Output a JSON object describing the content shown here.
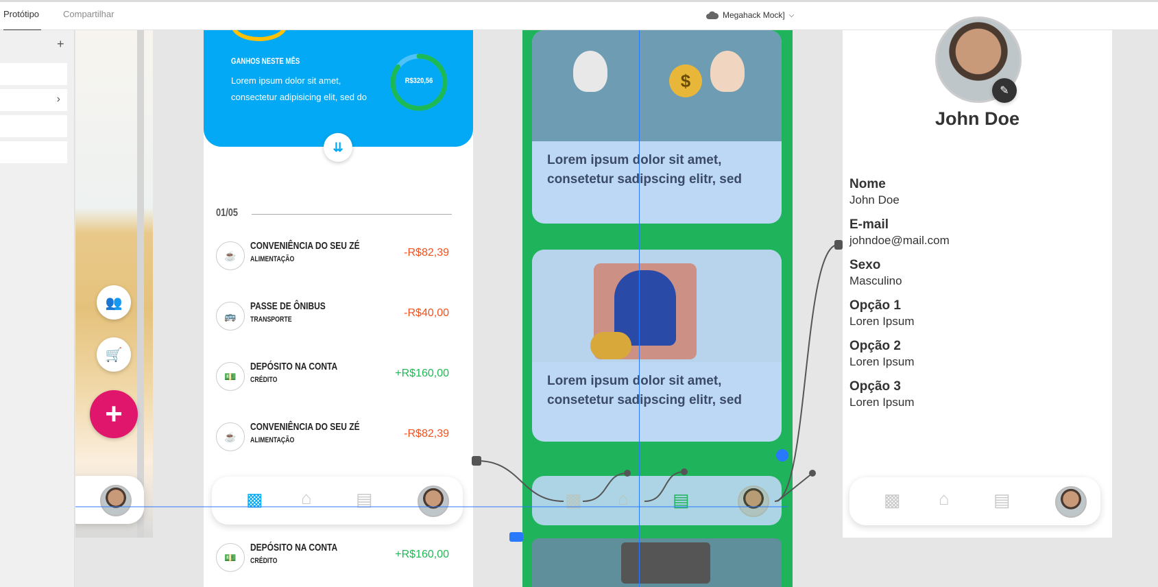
{
  "topbar": {
    "tabs": [
      {
        "label": "Protótipo"
      },
      {
        "label": "Compartilhar"
      }
    ],
    "doc_title": "Megahack Mock]"
  },
  "artboard2": {
    "earnings_title": "GANHOS NESTE MÊS",
    "earnings_text": "Lorem ipsum dolor sit amet, consectetur adipisicing elit, sed do",
    "earnings_value": "R$320,56",
    "earnings_progress": 0.85,
    "date": "01/05",
    "transactions": [
      {
        "title": "CONVENIÊNCIA DO SEU ZÉ",
        "category": "ALIMENTAÇÃO",
        "amount": "-R$82,39",
        "icon": "cup-icon",
        "type": "neg"
      },
      {
        "title": "PASSE DE ÔNIBUS",
        "category": "TRANSPORTE",
        "amount": "-R$40,00",
        "icon": "bus-icon",
        "type": "neg"
      },
      {
        "title": "DEPÓSITO NA CONTA",
        "category": "CRÉDITO",
        "amount": "+R$160,00",
        "icon": "cash-icon",
        "type": "pos"
      },
      {
        "title": "CONVENIÊNCIA DO SEU ZÉ",
        "category": "ALIMENTAÇÃO",
        "amount": "-R$82,39",
        "icon": "cup-icon",
        "type": "neg"
      },
      {
        "title": "DEPÓSITO NA CONTA",
        "category": "CRÉDITO",
        "amount": "+R$160,00",
        "icon": "cash-icon",
        "type": "pos"
      }
    ]
  },
  "artboard3": {
    "cards": [
      {
        "text": "Lorem ipsum dolor sit amet, consetetur sadipscing elitr, sed"
      },
      {
        "text": "Lorem ipsum dolor sit amet, consetetur sadipscing elitr, sed"
      }
    ]
  },
  "profile": {
    "name": "John Doe",
    "fields": [
      {
        "label": "Nome",
        "value": "John Doe"
      },
      {
        "label": "E-mail",
        "value": "johndoe@mail.com"
      },
      {
        "label": "Sexo",
        "value": "Masculino"
      },
      {
        "label": "Opção 1",
        "value": "Loren Ipsum"
      },
      {
        "label": "Opção 2",
        "value": "Loren Ipsum"
      },
      {
        "label": "Opção 3",
        "value": "Loren Ipsum"
      }
    ]
  },
  "colors": {
    "accent_blue": "#03a9f4",
    "magenta": "#e0166c",
    "green": "#1fb45b",
    "negative": "#f4511e",
    "positive": "#1db954"
  }
}
